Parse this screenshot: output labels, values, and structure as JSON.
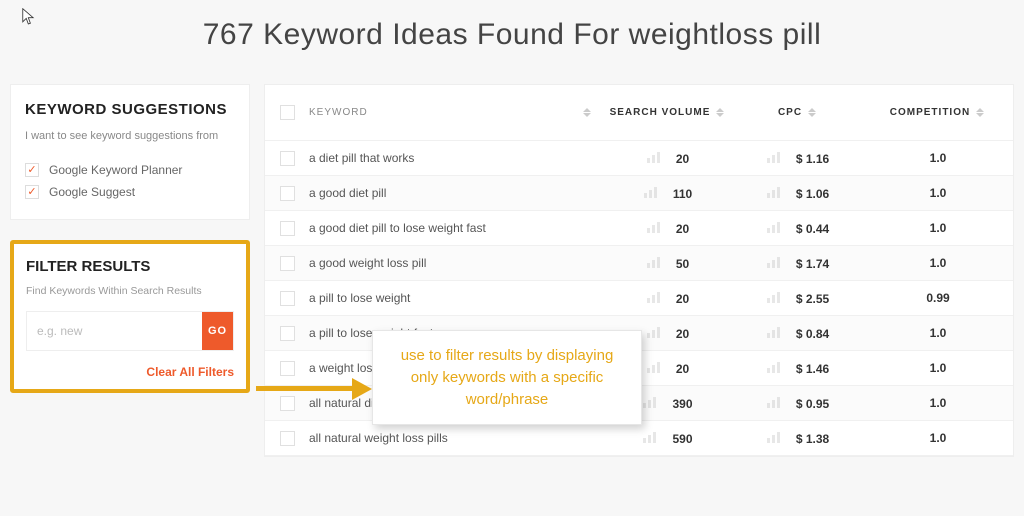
{
  "header": {
    "title": "767 Keyword Ideas Found For weightloss pill"
  },
  "sidebar": {
    "suggestions": {
      "heading": "KEYWORD SUGGESTIONS",
      "subtext": "I want to see keyword suggestions from",
      "sources": [
        {
          "label": "Google Keyword Planner",
          "checked": true
        },
        {
          "label": "Google Suggest",
          "checked": true
        }
      ]
    },
    "filter": {
      "heading": "FILTER RESULTS",
      "subtext": "Find Keywords Within Search Results",
      "placeholder": "e.g. new",
      "go_label": "GO",
      "clear_label": "Clear All Filters"
    }
  },
  "table": {
    "headers": {
      "keyword": "KEYWORD",
      "volume": "SEARCH VOLUME",
      "cpc": "CPC",
      "competition": "COMPETITION"
    },
    "rows": [
      {
        "keyword": "a diet pill that works",
        "volume": "20",
        "cpc": "$ 1.16",
        "competition": "1.0"
      },
      {
        "keyword": "a good diet pill",
        "volume": "110",
        "cpc": "$ 1.06",
        "competition": "1.0"
      },
      {
        "keyword": "a good diet pill to lose weight fast",
        "volume": "20",
        "cpc": "$ 0.44",
        "competition": "1.0"
      },
      {
        "keyword": "a good weight loss pill",
        "volume": "50",
        "cpc": "$ 1.74",
        "competition": "1.0"
      },
      {
        "keyword": "a pill to lose weight",
        "volume": "20",
        "cpc": "$ 2.55",
        "competition": "0.99"
      },
      {
        "keyword": "a pill to lose weight fast",
        "volume": "20",
        "cpc": "$ 0.84",
        "competition": "1.0"
      },
      {
        "keyword": "a weight loss pill",
        "volume": "20",
        "cpc": "$ 1.46",
        "competition": "1.0"
      },
      {
        "keyword": "all natural diet pills",
        "volume": "390",
        "cpc": "$ 0.95",
        "competition": "1.0"
      },
      {
        "keyword": "all natural weight loss pills",
        "volume": "590",
        "cpc": "$ 1.38",
        "competition": "1.0"
      }
    ]
  },
  "annotation": {
    "text": "use to filter results by displaying only keywords with a specific word/phrase"
  },
  "colors": {
    "accent_orange": "#ee5a2b",
    "annotation_gold": "#e6a817"
  }
}
